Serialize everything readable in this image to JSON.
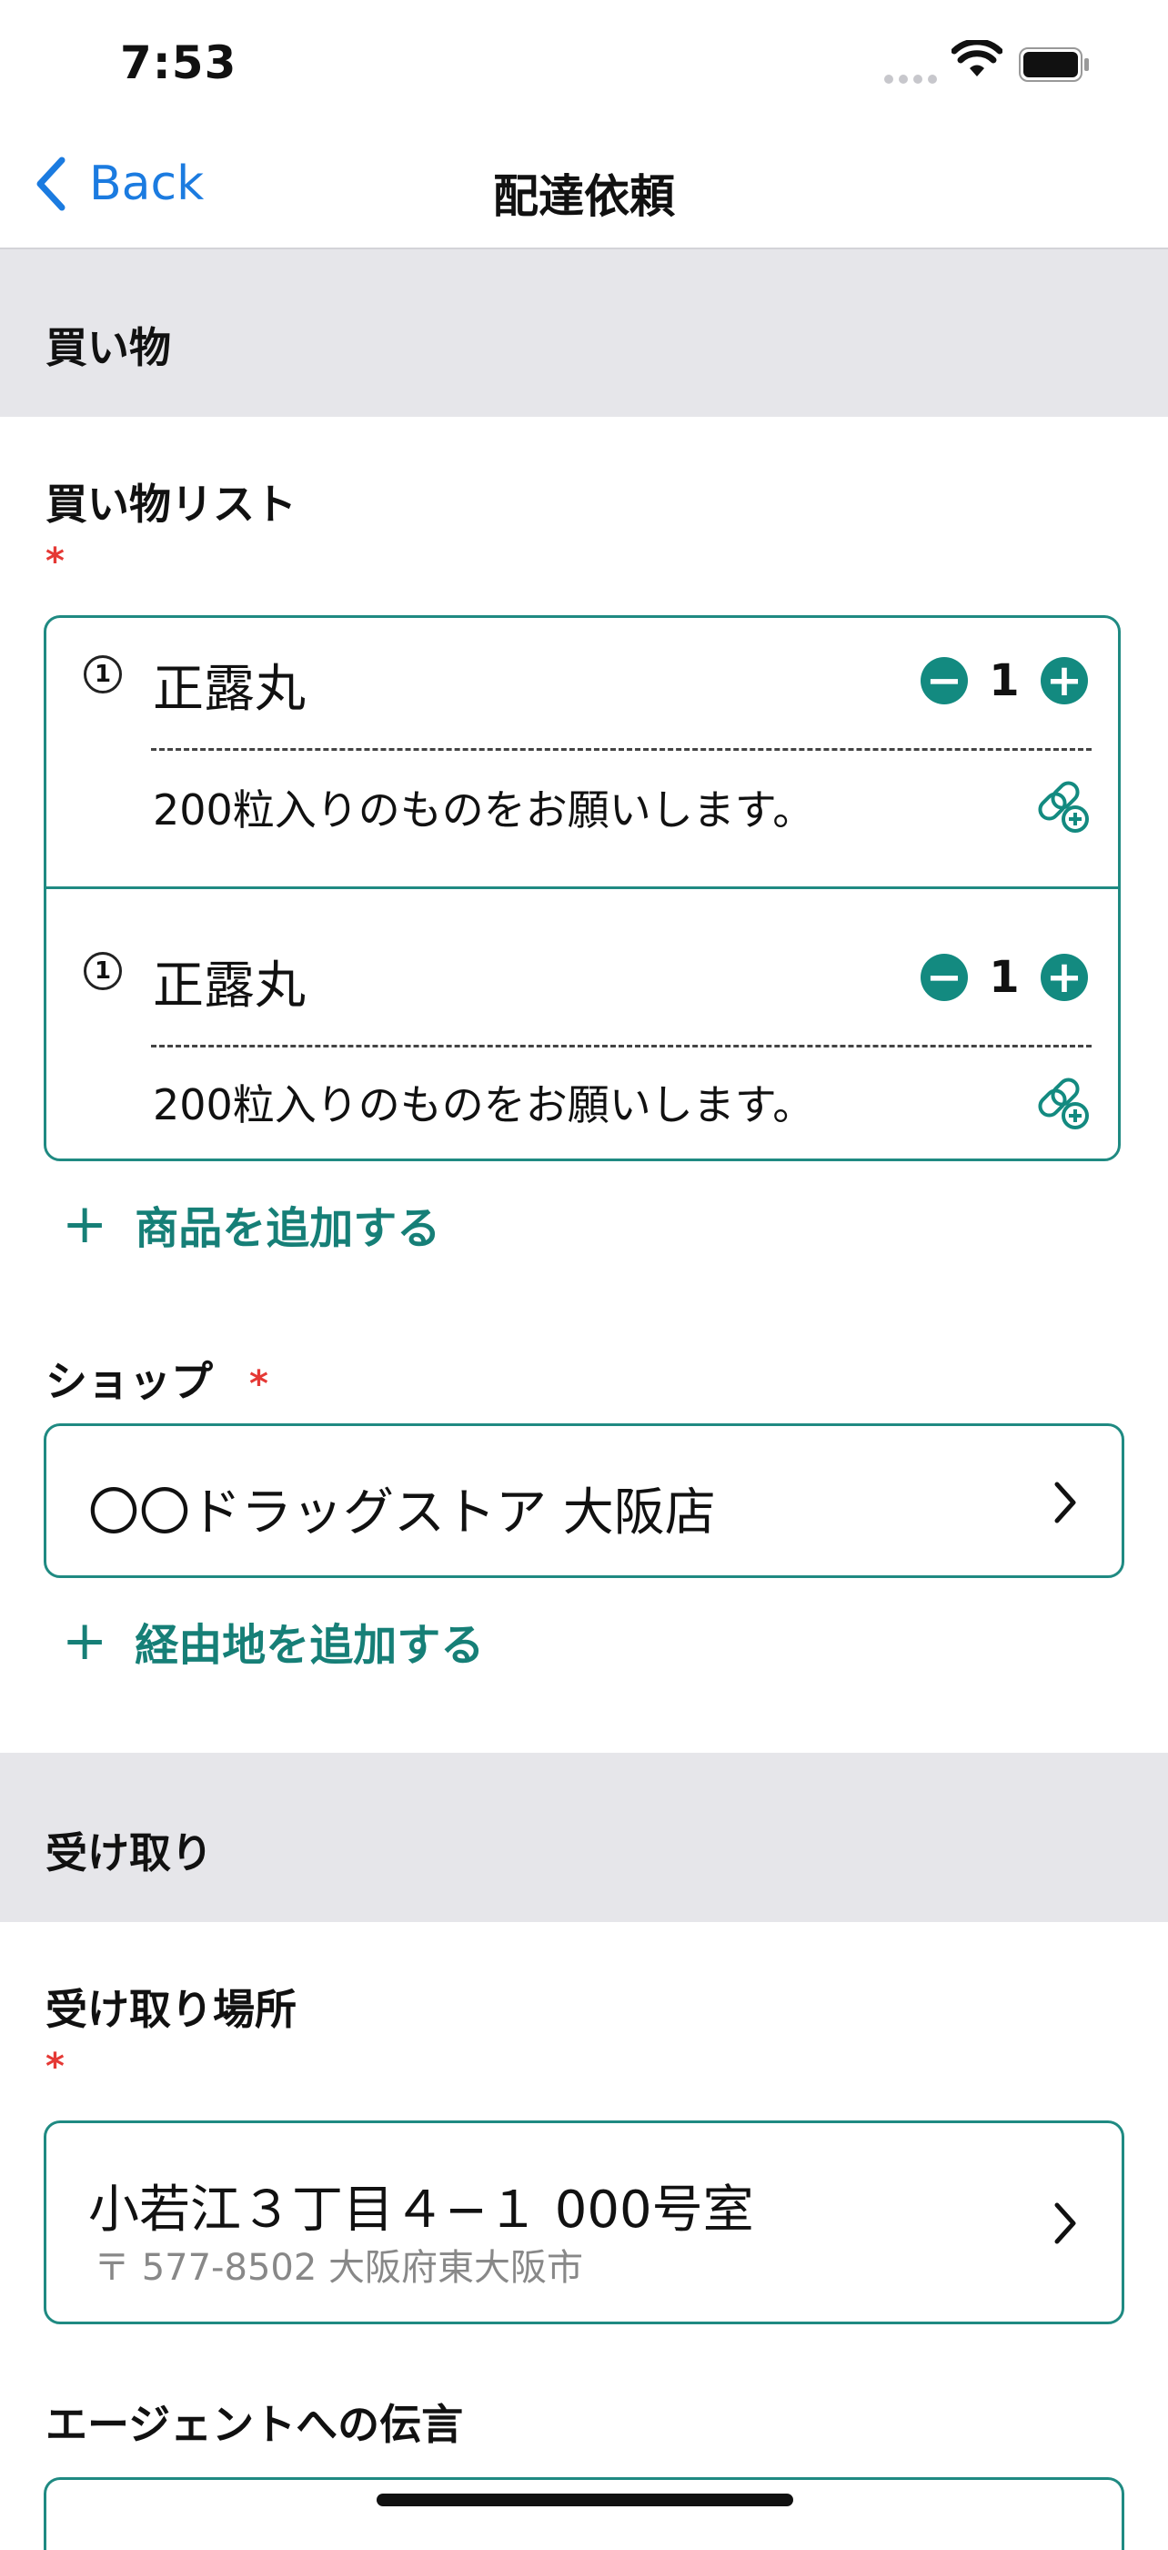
{
  "status_bar": {
    "time": "7:53"
  },
  "nav": {
    "back_label": "Back",
    "title": "配達依頼"
  },
  "shopping_section": {
    "title": "買い物"
  },
  "shopping_list": {
    "label": "買い物リスト",
    "required_mark": "*",
    "items": [
      {
        "index": "1",
        "name": "正露丸",
        "quantity": "1",
        "note": "200粒入りのものをお願いします。"
      },
      {
        "index": "1",
        "name": "正露丸",
        "quantity": "1",
        "note": "200粒入りのものをお願いします。"
      }
    ],
    "add_item_label": "商品を追加する"
  },
  "shop": {
    "label": "ショップ",
    "required_mark": "*",
    "value": "〇〇ドラッグストア 大阪店",
    "add_waypoint_label": "経由地を追加する"
  },
  "receive_section": {
    "title": "受け取り"
  },
  "receive_place": {
    "label": "受け取り場所",
    "required_mark": "*",
    "address_line": "小若江３丁目４−１ 000号室",
    "postal_line": "〒 577-8502 大阪府東大阪市"
  },
  "agent_message": {
    "label": "エージェントへの伝言"
  },
  "colors": {
    "accent": "#138a80",
    "link_blue": "#1b7be0",
    "section_bg": "#e6e6ea",
    "required": "#e53935"
  }
}
